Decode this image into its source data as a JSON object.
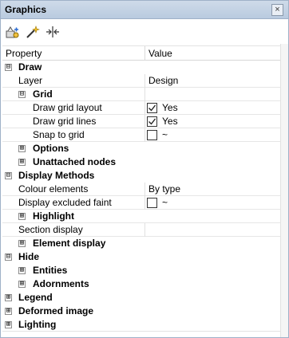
{
  "window": {
    "title": "Graphics",
    "close_glyph": "×"
  },
  "toolbar": {
    "icons": [
      "properties-tool-icon",
      "magic-wand-icon",
      "fit-extents-icon"
    ]
  },
  "header": {
    "property": "Property",
    "value": "Value"
  },
  "rows": {
    "draw": {
      "label": "Draw",
      "expander": "⊟"
    },
    "layer": {
      "label": "Layer",
      "value": "Design"
    },
    "grid": {
      "label": "Grid",
      "expander": "⊟"
    },
    "draw_grid_layout": {
      "label": "Draw grid layout",
      "value": "Yes",
      "checked": true
    },
    "draw_grid_lines": {
      "label": "Draw grid lines",
      "value": "Yes",
      "checked": true
    },
    "snap_to_grid": {
      "label": "Snap to grid",
      "value": "~",
      "checked": false
    },
    "options": {
      "label": "Options",
      "expander": "⊞"
    },
    "unattached_nodes": {
      "label": "Unattached nodes",
      "expander": "⊞"
    },
    "display_methods": {
      "label": "Display Methods",
      "expander": "⊟"
    },
    "colour_elements": {
      "label": "Colour elements",
      "value": "By type"
    },
    "display_excluded_faint": {
      "label": "Display excluded faint",
      "value": "~",
      "checked": false
    },
    "highlight": {
      "label": "Highlight",
      "expander": "⊞"
    },
    "section_display": {
      "label": "Section display",
      "value": ""
    },
    "element_display": {
      "label": "Element display",
      "expander": "⊞"
    },
    "hide": {
      "label": "Hide",
      "expander": "⊟"
    },
    "entities": {
      "label": "Entities",
      "expander": "⊞"
    },
    "adornments": {
      "label": "Adornments",
      "expander": "⊞"
    },
    "legend": {
      "label": "Legend",
      "expander": "⊞"
    },
    "deformed_image": {
      "label": "Deformed image",
      "expander": "⊞"
    },
    "lighting": {
      "label": "Lighting",
      "expander": "⊞"
    }
  }
}
